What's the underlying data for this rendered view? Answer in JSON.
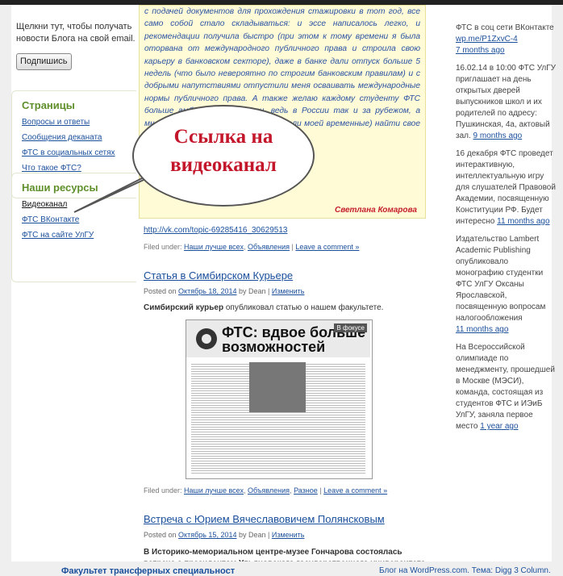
{
  "left_sidebar": {
    "subscribe_text": "Щелкни тут, чтобы получать новости Блога на свой email.",
    "subscribe_button": "Подпишись",
    "pages_title": "Страницы",
    "pages": [
      "Вопросы и ответы",
      "Сообщения деканата",
      "ФТС в социальных сетях",
      "Что такое ФТС?"
    ],
    "resources_title": "Наши ресурсы",
    "resources": [
      "Видеоканал",
      "ФТС ВКонтакте",
      "ФТС на сайте УлГУ"
    ]
  },
  "quote": {
    "text": "с подачей документов для прохождения стажировки в тот год, все само собой стало складываться: и эссе написалось легко, и рекомендации получила быстро (при этом к тому времени я была оторвана от международного публичного права и строила свою карьеру в банковском секторе), даже в банке дали отпуск больше 5 недель (что было невероятно по строгим банковским правилам) и с добрыми напутствиями отпустили меня осваивать международные нормы публичного права. А также желаю каждому студенту ФТС больше амбиций и смелости, ведь в России так и за рубежом, а много не бывает, а больше, чем стали моей временные) найти свое ФТС с",
    "author": "Светлана Комарова"
  },
  "callout": {
    "line1": "Ссылка на",
    "line2": "видеоканал"
  },
  "post1": {
    "link": "http://vk.com/topic-69285416_30629513",
    "filed_label": "Filed under:",
    "cat1": "Наши лучше всех",
    "cat2": "Объявления",
    "comment": "Leave a comment »"
  },
  "post2": {
    "title": "Статья в Симбирском Курьере",
    "posted": "Posted on",
    "date": "Октябрь 18, 2014",
    "by": "by Dean |",
    "edit": "Изменить",
    "excerpt_bold": "Симбирский курьер",
    "excerpt_rest": " опубликовал статью о нашем факультете.",
    "np_title_1": "ФТС: вдвое больше",
    "np_title_2": "возможностей",
    "np_badge": "В фокусе",
    "filed_label": "Filed under:",
    "cat1": "Наши лучше всех",
    "cat2": "Объявления",
    "cat3": "Разное",
    "comment": "Leave a comment »"
  },
  "post3": {
    "title": "Встреча с Юрием Вячеславовичем Полянсковым",
    "posted": "Posted on",
    "date": "Октябрь 15, 2014",
    "by": "by Dean |",
    "edit": "Изменить",
    "excerpt": "В Историко-мемориальном центре-музее Гончарова состоялась встреча с президентом Ульяновского государственного университета, лауреатом"
  },
  "right_sidebar": {
    "i1_text": "ФТС в соц сети ВКонтакте",
    "i1_link": "wp.me/P1ZxvC-4",
    "i1_time": "7 months ago",
    "i2_text": "16.02.14 в 10:00 ФТС УлГУ приглашает на день открытых дверей выпускников школ и их родителей по адресу: Пушкинская, 4а, актовый зал.",
    "i2_time": "9 months ago",
    "i3_text": "16 декабря ФТС проведет интерактивную, интеллектуальную игру для слушателей Правовой Академии, посвященную Конституции РФ. Будет интересно",
    "i3_time": "11 months ago",
    "i4_text": "Издательство Lambert Academic Publishing опубликовало монографию студентки ФТС УлГУ Оксаны Ярославской, посвященную вопросам налогообложения",
    "i4_time": "11 months ago",
    "i5_text": "На Всероссийской олимпиаде по менеджменту, прошедшей в Москве (МЭСИ), команда, состоящая из студентов ФТС и ИЭиБ УлГУ, заняла первое место",
    "i5_time": "1 year ago"
  },
  "footer": {
    "site": "Факультет трансферных специальност",
    "right": "Блог на WordPress.com. Тема: Digg 3 Column."
  }
}
